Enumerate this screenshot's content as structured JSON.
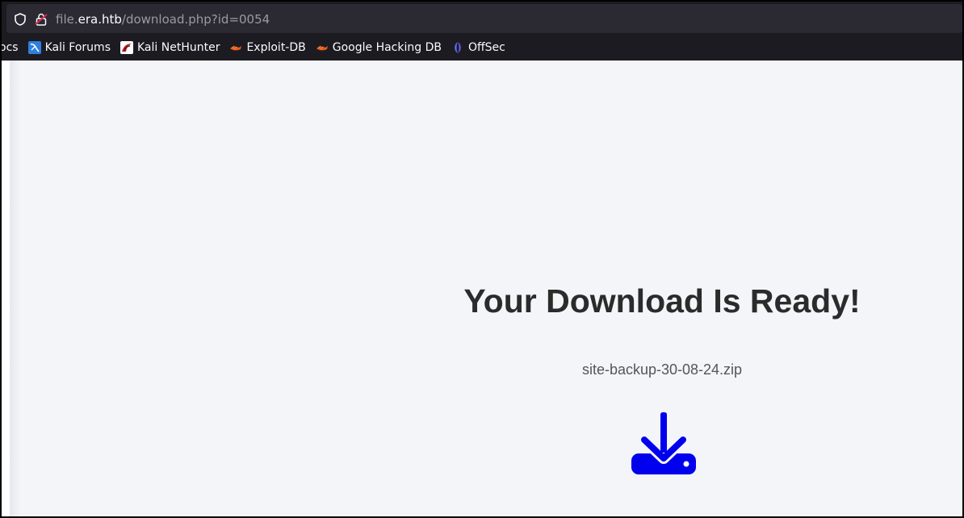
{
  "browser": {
    "url_scheme_part": "file.",
    "url_domain": "era.htb",
    "url_path": "/download.php?id=0054",
    "bookmarks_cut_label": "ocs",
    "bookmarks": [
      {
        "label": "Kali Forums",
        "icon": "kali-forums-icon"
      },
      {
        "label": "Kali NetHunter",
        "icon": "kali-nethunter-icon"
      },
      {
        "label": "Exploit-DB",
        "icon": "exploit-db-icon"
      },
      {
        "label": "Google Hacking DB",
        "icon": "google-hacking-db-icon"
      },
      {
        "label": "OffSec",
        "icon": "offsec-icon"
      }
    ]
  },
  "page": {
    "heading": "Your Download Is Ready!",
    "filename": "site-backup-30-08-24.zip",
    "download_icon": "download-icon",
    "accent_color": "#0000ee"
  }
}
